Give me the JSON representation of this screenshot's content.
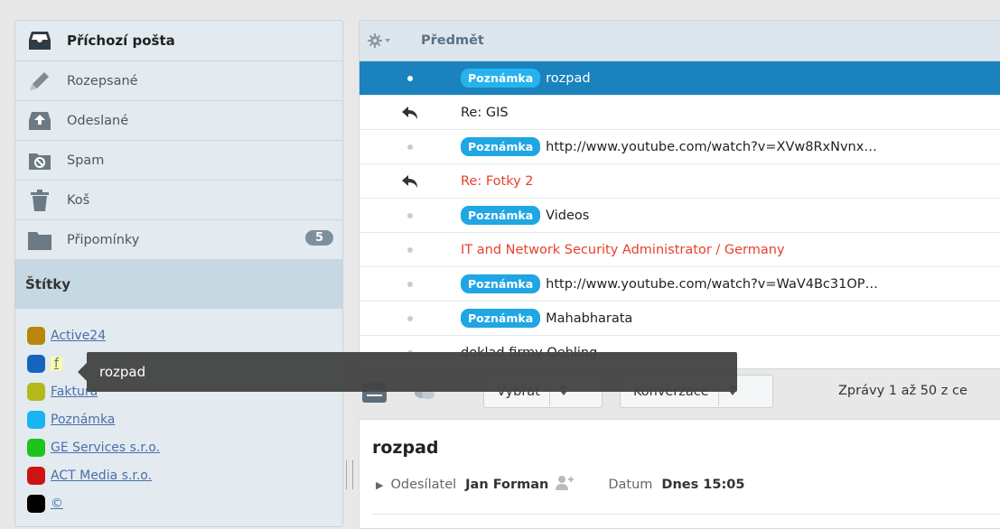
{
  "sidebar": {
    "folders": [
      {
        "label": "Příchozí pošta",
        "icon": "inbox-icon"
      },
      {
        "label": "Rozepsané",
        "icon": "pencil-icon"
      },
      {
        "label": "Odeslané",
        "icon": "sent-icon"
      },
      {
        "label": "Spam",
        "icon": "spam-icon"
      },
      {
        "label": "Koš",
        "icon": "trash-icon"
      },
      {
        "label": "Připomínky",
        "icon": "folder-icon",
        "badge": "5"
      }
    ],
    "labels_title": "Štítky",
    "labels": [
      {
        "name": "Active24",
        "color": "#b8860b"
      },
      {
        "name": "f",
        "color": "#1565c0"
      },
      {
        "name": "Faktura",
        "color": "#b5b81a"
      },
      {
        "name": "Poznámka",
        "color": "#19b5f2"
      },
      {
        "name": "GE Services s.r.o.",
        "color": "#1cc41c"
      },
      {
        "name": "ACT Media s.r.o.",
        "color": "#cc1414"
      },
      {
        "name": "©",
        "color": "#000000"
      }
    ]
  },
  "list": {
    "header_subject": "Předmět",
    "rows": [
      {
        "tag": "Poznámka",
        "subject": "rozpad"
      },
      {
        "subject": "Re: GIS"
      },
      {
        "tag": "Poznámka",
        "subject": "http://www.youtube.com/watch?v=XVw8RxNvnx…"
      },
      {
        "subject": "Re: Fotky 2"
      },
      {
        "tag": "Poznámka",
        "subject": "Videos"
      },
      {
        "subject": "IT and Network Security Administrator / Germany"
      },
      {
        "tag": "Poznámka",
        "subject": "http://www.youtube.com/watch?v=WaV4Bc31OP…"
      },
      {
        "tag": "Poznámka",
        "subject": "Mahabharata"
      },
      {
        "subject": "doklad firmy Oehling"
      }
    ]
  },
  "toolbar": {
    "select_label": "Vybrat",
    "conversation_label": "Konverzace",
    "count_text": "Zprávy 1 až 50 z ce"
  },
  "preview": {
    "subject": "rozpad",
    "sender_label": "Odesílatel",
    "sender": "Jan Forman",
    "date_label": "Datum",
    "date": "Dnes 15:05"
  },
  "tooltip": {
    "text": "rozpad"
  }
}
